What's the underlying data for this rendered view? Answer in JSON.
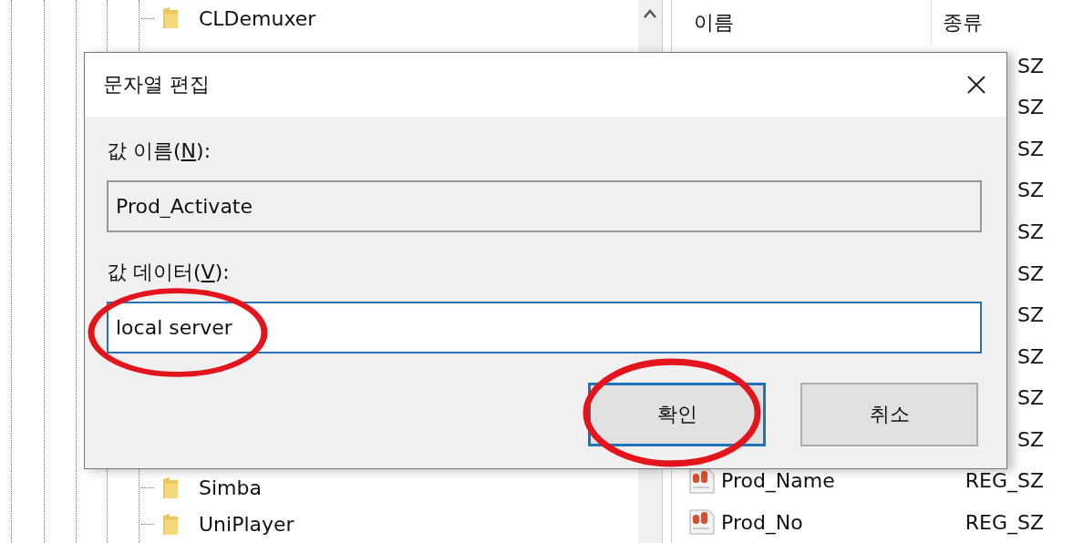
{
  "tree": {
    "items_above": [
      {
        "label": "CLDemuxer"
      }
    ],
    "items_below": [
      {
        "label": "Simba"
      },
      {
        "label": "UniPlayer"
      }
    ]
  },
  "values_list": {
    "columns": [
      "이름",
      "종류"
    ],
    "rows": [
      {
        "type": "SZ"
      },
      {
        "type": "SZ"
      },
      {
        "type": "SZ"
      },
      {
        "type": "SZ"
      },
      {
        "type": "SZ"
      },
      {
        "type": "SZ"
      },
      {
        "type": "SZ"
      },
      {
        "type": "SZ"
      },
      {
        "type": "SZ"
      },
      {
        "type": "SZ"
      },
      {
        "name": "Prod_Name",
        "type": "REG_SZ"
      },
      {
        "name": "Prod_No",
        "type": "REG_SZ"
      }
    ]
  },
  "dialog": {
    "title": "문자열 편집",
    "fields": [
      {
        "label_before": "값 이름(",
        "mnemonic": "N",
        "label_after": "):",
        "value": "Prod_Activate",
        "disabled": true,
        "circled": false
      },
      {
        "label_before": "값 데이터(",
        "mnemonic": "V",
        "label_after": "):",
        "value": "local server",
        "disabled": false,
        "circled": true
      }
    ],
    "buttons": [
      {
        "label": "확인",
        "default": true,
        "circled": true
      },
      {
        "label": "취소",
        "default": false,
        "circled": false
      }
    ]
  }
}
